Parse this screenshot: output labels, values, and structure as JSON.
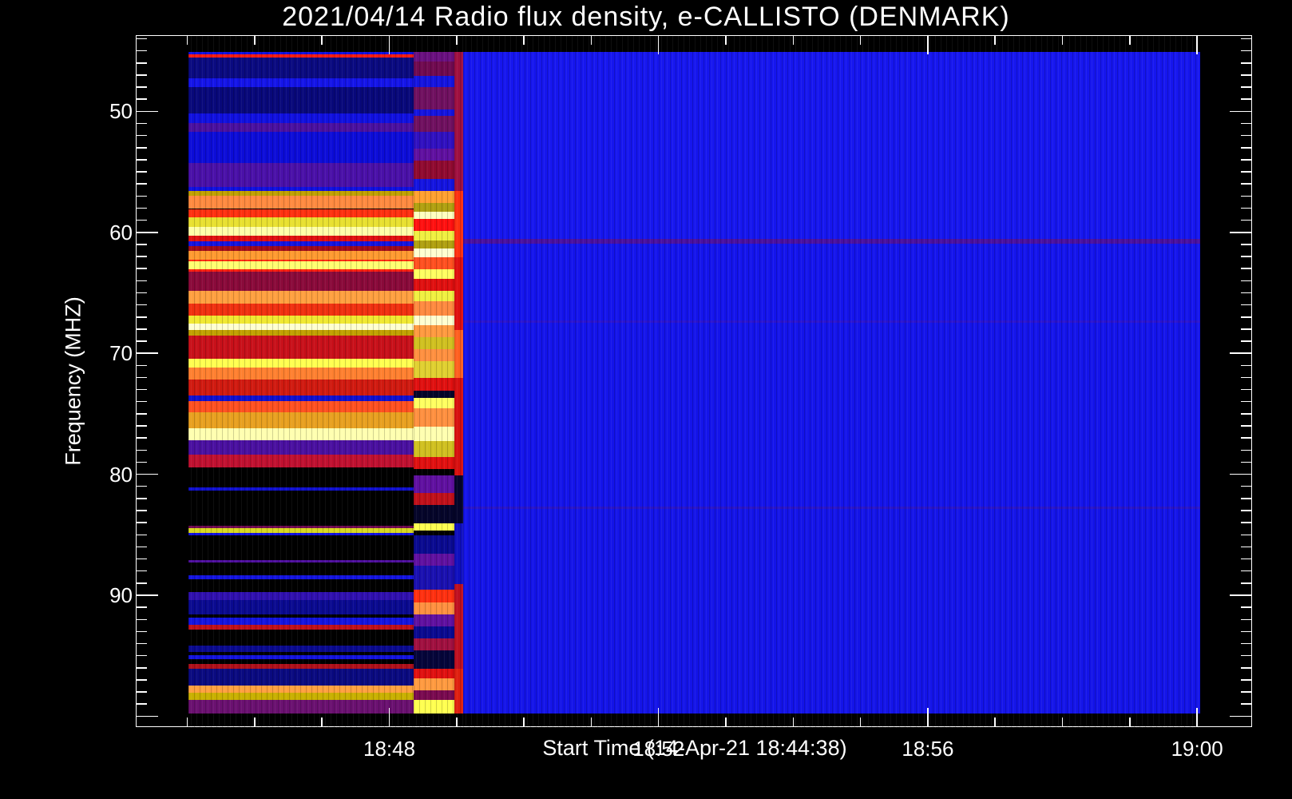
{
  "chart_data": {
    "type": "heatmap",
    "title": "2021/04/14  Radio flux density, e-CALLISTO (DENMARK)",
    "xlabel": "Start Time (14-Apr-21 18:44:38)",
    "ylabel": "Frequency (MHZ)",
    "xlim": [
      "18:44:14",
      "19:00:49"
    ],
    "ylim": [
      100.9,
      43.7
    ],
    "x_ticks": [
      "18:48",
      "18:52",
      "18:56",
      "19:00"
    ],
    "y_ticks": [
      50,
      60,
      70,
      80,
      90
    ],
    "colormap": "blue-red-yellow-white (black = low)",
    "segments": [
      {
        "name": "segment-1",
        "start": "18:45:00",
        "end": "18:48:21",
        "bands": [
          [
            45.0,
            45.2,
            "#1010e0"
          ],
          [
            45.2,
            45.5,
            "#ff1a10"
          ],
          [
            45.5,
            47.2,
            "#0a0a80"
          ],
          [
            47.2,
            47.9,
            "#1414e8"
          ],
          [
            47.9,
            50.1,
            "#08087a"
          ],
          [
            50.1,
            50.9,
            "#1010e0"
          ],
          [
            50.9,
            51.6,
            "#4a10a0"
          ],
          [
            51.6,
            54.2,
            "#0c0cd8"
          ],
          [
            54.2,
            56.2,
            "#4a10a8"
          ],
          [
            56.2,
            56.5,
            "#1010e0"
          ],
          [
            56.5,
            56.9,
            "#c0a000"
          ],
          [
            56.9,
            58.0,
            "#ff8a40"
          ],
          [
            58.0,
            58.7,
            "#ff3010"
          ],
          [
            58.7,
            59.5,
            "#e8e030"
          ],
          [
            59.5,
            60.2,
            "#ffffa8"
          ],
          [
            60.2,
            60.7,
            "#e01010"
          ],
          [
            60.7,
            61.1,
            "#1414e0"
          ],
          [
            61.1,
            61.5,
            "#a00a1a"
          ],
          [
            61.5,
            62.2,
            "#ff9a30"
          ],
          [
            62.2,
            62.3,
            "#ff2a10"
          ],
          [
            62.3,
            63.0,
            "#ffff70"
          ],
          [
            63.0,
            63.2,
            "#ff2010"
          ],
          [
            63.2,
            64.8,
            "#8a0a3a"
          ],
          [
            64.8,
            65.8,
            "#ffa040"
          ],
          [
            65.8,
            66.8,
            "#f03010"
          ],
          [
            66.8,
            67.5,
            "#f0e830"
          ],
          [
            67.5,
            68.0,
            "#ffffd0"
          ],
          [
            68.0,
            68.5,
            "#c0a000"
          ],
          [
            68.5,
            70.4,
            "#c8101a"
          ],
          [
            70.4,
            71.1,
            "#ffff50"
          ],
          [
            71.1,
            72.1,
            "#ff8030"
          ],
          [
            72.1,
            73.4,
            "#d01a10"
          ],
          [
            73.4,
            73.9,
            "#1010d0"
          ],
          [
            73.9,
            74.8,
            "#ff5020"
          ],
          [
            74.8,
            76.1,
            "#e8a020"
          ],
          [
            76.1,
            77.1,
            "#ffffb0"
          ],
          [
            77.1,
            78.3,
            "#4a10a0"
          ],
          [
            78.3,
            79.4,
            "#c01030"
          ],
          [
            79.4,
            81.0,
            "#000000"
          ],
          [
            81.0,
            81.3,
            "#1010d0"
          ],
          [
            81.3,
            84.2,
            "#000000"
          ],
          [
            84.2,
            84.4,
            "#700a50"
          ],
          [
            84.4,
            84.8,
            "#d8d820"
          ],
          [
            84.8,
            85.0,
            "#1010e0"
          ],
          [
            85.0,
            87.0,
            "#000000"
          ],
          [
            87.0,
            87.2,
            "#5010a0"
          ],
          [
            87.2,
            88.3,
            "#000000"
          ],
          [
            88.3,
            88.6,
            "#1414e0"
          ],
          [
            88.6,
            89.7,
            "#000000"
          ],
          [
            89.7,
            90.3,
            "#3010b0"
          ],
          [
            90.3,
            91.5,
            "#0a0a90"
          ],
          [
            91.5,
            91.8,
            "#000000"
          ],
          [
            91.8,
            92.4,
            "#1414e0"
          ],
          [
            92.4,
            92.8,
            "#c0101a"
          ],
          [
            92.8,
            94.1,
            "#000000"
          ],
          [
            94.1,
            94.6,
            "#0a0a90"
          ],
          [
            94.6,
            94.9,
            "#000000"
          ],
          [
            94.9,
            95.2,
            "#1414e0"
          ],
          [
            95.2,
            95.6,
            "#000000"
          ],
          [
            95.6,
            96.0,
            "#b0101a"
          ],
          [
            96.0,
            97.4,
            "#0a0a80"
          ],
          [
            97.4,
            98.0,
            "#ffa040"
          ],
          [
            98.0,
            98.6,
            "#c8b000"
          ],
          [
            98.6,
            99.7,
            "#6a1070"
          ]
        ]
      },
      {
        "name": "segment-2",
        "start": "18:48:21",
        "end": "18:48:57",
        "bands": [
          [
            45.0,
            45.8,
            "#6a1080"
          ],
          [
            45.8,
            47.0,
            "#700a50"
          ],
          [
            47.0,
            47.9,
            "#1414e0"
          ],
          [
            47.9,
            49.8,
            "#701060"
          ],
          [
            49.8,
            50.3,
            "#1414e0"
          ],
          [
            50.3,
            51.6,
            "#701060"
          ],
          [
            51.6,
            53.0,
            "#3010c0"
          ],
          [
            53.0,
            54.0,
            "#6010a0"
          ],
          [
            54.0,
            55.5,
            "#900a30"
          ],
          [
            55.5,
            56.5,
            "#1414e0"
          ],
          [
            56.5,
            57.5,
            "#ffa030"
          ],
          [
            57.5,
            58.2,
            "#b0a010"
          ],
          [
            58.2,
            58.8,
            "#ffffc0"
          ],
          [
            58.8,
            59.8,
            "#ff1010"
          ],
          [
            59.8,
            60.6,
            "#f0f040"
          ],
          [
            60.6,
            61.3,
            "#b0a010"
          ],
          [
            61.3,
            62.0,
            "#ffffd0"
          ],
          [
            62.0,
            63.0,
            "#ff5020"
          ],
          [
            63.0,
            63.8,
            "#ffff60"
          ],
          [
            63.8,
            64.8,
            "#e01010"
          ],
          [
            64.8,
            65.6,
            "#f0f040"
          ],
          [
            65.6,
            66.8,
            "#ff8a40"
          ],
          [
            66.8,
            67.6,
            "#ffffd0"
          ],
          [
            67.6,
            68.6,
            "#ff9a40"
          ],
          [
            68.6,
            69.6,
            "#d0c020"
          ],
          [
            69.6,
            70.6,
            "#ff9040"
          ],
          [
            70.6,
            72.0,
            "#e0d030"
          ],
          [
            72.0,
            73.0,
            "#e01010"
          ],
          [
            73.0,
            73.6,
            "#05052a"
          ],
          [
            73.6,
            74.5,
            "#ffff60"
          ],
          [
            74.5,
            76.0,
            "#ff9040"
          ],
          [
            76.0,
            77.2,
            "#ffffb0"
          ],
          [
            77.2,
            78.5,
            "#d0c020"
          ],
          [
            78.5,
            79.5,
            "#e01010"
          ],
          [
            79.5,
            80.0,
            "#000000"
          ],
          [
            80.0,
            81.5,
            "#6010a0"
          ],
          [
            81.5,
            82.5,
            "#c0101a"
          ],
          [
            82.5,
            84.0,
            "#05052a"
          ],
          [
            84.0,
            84.6,
            "#ffff50"
          ],
          [
            84.6,
            85.0,
            "#000000"
          ],
          [
            85.0,
            86.5,
            "#0a0a90"
          ],
          [
            86.5,
            87.5,
            "#6010a0"
          ],
          [
            87.5,
            89.5,
            "#1a10b0"
          ],
          [
            89.5,
            90.5,
            "#ff3010"
          ],
          [
            90.5,
            91.5,
            "#ff9040"
          ],
          [
            91.5,
            92.5,
            "#6010a0"
          ],
          [
            92.5,
            93.5,
            "#0a0a90"
          ],
          [
            93.5,
            94.5,
            "#a01040"
          ],
          [
            94.5,
            96.0,
            "#05053a"
          ],
          [
            96.0,
            96.8,
            "#e01010"
          ],
          [
            96.8,
            97.8,
            "#ff9a40"
          ],
          [
            97.8,
            98.6,
            "#7a0a50"
          ],
          [
            98.6,
            99.7,
            "#ffff50"
          ]
        ]
      },
      {
        "name": "segment-3",
        "start": "18:48:57",
        "end": "18:49:05",
        "bands": [
          [
            45.0,
            56.5,
            "#a01040"
          ],
          [
            56.5,
            62.0,
            "#ff3010"
          ],
          [
            62.0,
            68.0,
            "#e01010"
          ],
          [
            68.0,
            72.0,
            "#ff6020"
          ],
          [
            72.0,
            80.0,
            "#d81010"
          ],
          [
            80.0,
            84.0,
            "#05052a"
          ],
          [
            84.0,
            89.0,
            "#1010c0"
          ],
          [
            89.0,
            96.0,
            "#c01020"
          ],
          [
            96.0,
            99.7,
            "#e02010"
          ]
        ]
      },
      {
        "name": "segment-4",
        "start": "18:49:05",
        "end": "19:00:02",
        "bands": [
          [
            45.0,
            60.5,
            "#1616ee"
          ],
          [
            60.5,
            60.85,
            "#4a10a0"
          ],
          [
            60.85,
            67.2,
            "#1414ec"
          ],
          [
            67.2,
            67.4,
            "#2a14d0"
          ],
          [
            67.4,
            82.6,
            "#1414ea"
          ],
          [
            82.6,
            82.8,
            "#2a14c8"
          ],
          [
            82.8,
            99.7,
            "#1414e8"
          ]
        ]
      }
    ]
  }
}
